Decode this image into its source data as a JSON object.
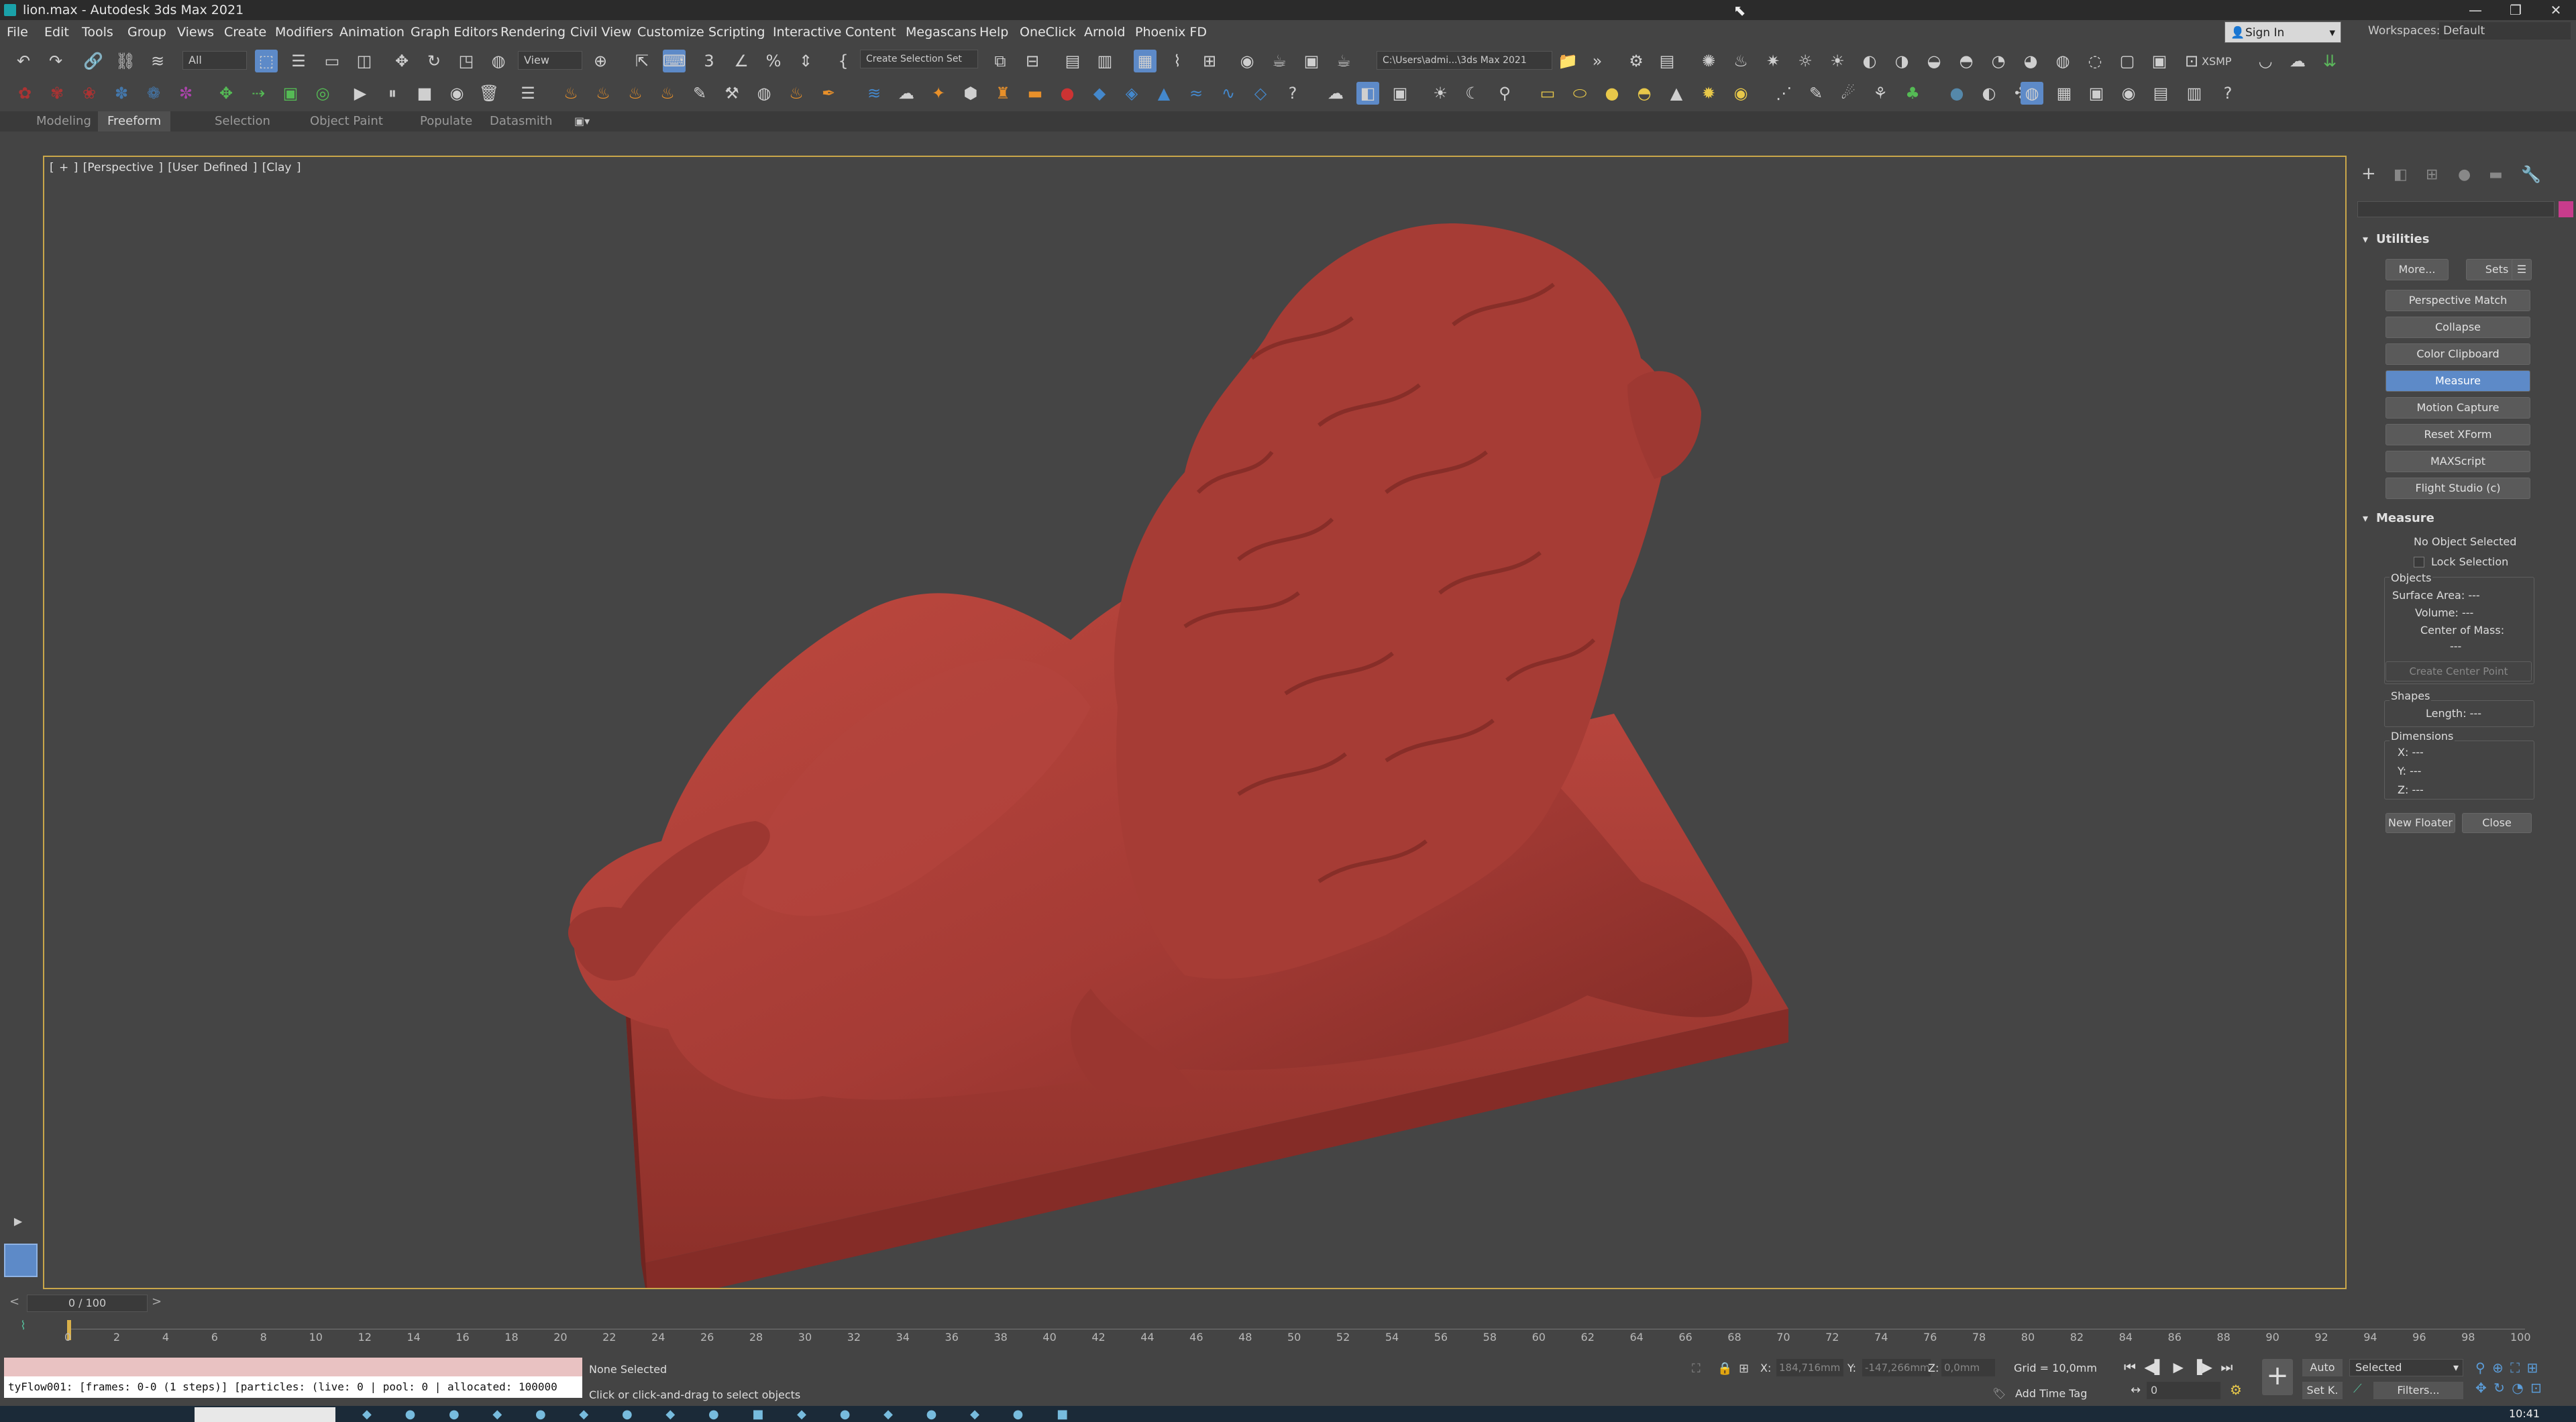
{
  "window": {
    "title": "lion.max - Autodesk 3ds Max 2021",
    "minimize": "—",
    "restore": "❐",
    "close": "✕"
  },
  "menu": [
    "File",
    "Edit",
    "Tools",
    "Group",
    "Views",
    "Create",
    "Modifiers",
    "Animation",
    "Graph Editors",
    "Rendering",
    "Civil View",
    "Customize",
    "Scripting",
    "Interactive",
    "Content",
    "Megascans",
    "Help",
    "OneClick",
    "Arnold",
    "Phoenix FD"
  ],
  "header": {
    "sign_in": "Sign In",
    "workspaces_label": "Workspaces:",
    "workspace_value": "Default"
  },
  "toolbar": {
    "filter_value": "All",
    "refcoord_value": "View",
    "selection_set_placeholder": "Create Selection Set",
    "project_path": "C:\\Users\\admi...\\3ds Max 2021",
    "xsmp_label": "XSMP"
  },
  "ribbon_tabs": [
    "Modeling",
    "Freeform",
    "Selection",
    "Object Paint",
    "Populate",
    "Datasmith"
  ],
  "ribbon_active": "Freeform",
  "viewport": {
    "label": "[ + ] [Perspective ] [User Defined ] [Clay ]",
    "object_color": "#b1413a",
    "background": "#454545"
  },
  "utilities": {
    "title": "Utilities",
    "more_label": "More...",
    "sets_label": "Sets",
    "buttons": [
      "Perspective Match",
      "Collapse",
      "Color Clipboard",
      "Measure",
      "Motion Capture",
      "Reset XForm",
      "MAXScript",
      "Flight Studio (c)"
    ],
    "active": "Measure"
  },
  "measure": {
    "title": "Measure",
    "no_object": "No Object Selected",
    "lock_selection": "Lock Selection",
    "objects_label": "Objects",
    "surface_area": "Surface Area: ---",
    "volume": "Volume: ---",
    "center_of_mass": "Center of Mass:",
    "com_value": "---",
    "create_center_point": "Create Center Point",
    "shapes_label": "Shapes",
    "length": "Length: ---",
    "dimensions_label": "Dimensions",
    "x": "X: ---",
    "y": "Y: ---",
    "z": "Z: ---",
    "new_floater": "New Floater",
    "close": "Close"
  },
  "timeslider": {
    "frame": "0 / 100",
    "prev": "<",
    "next": ">"
  },
  "trackbar": {
    "ticks": [
      "0",
      "2",
      "4",
      "6",
      "8",
      "10",
      "12",
      "14",
      "16",
      "18",
      "20",
      "22",
      "24",
      "26",
      "28",
      "30",
      "32",
      "34",
      "36",
      "38",
      "40",
      "42",
      "44",
      "46",
      "48",
      "50",
      "52",
      "54",
      "56",
      "58",
      "60",
      "62",
      "64",
      "66",
      "68",
      "70",
      "72",
      "74",
      "76",
      "78",
      "80",
      "82",
      "84",
      "86",
      "88",
      "90",
      "92",
      "94",
      "96",
      "98",
      "100"
    ]
  },
  "status": {
    "listener": "tyFlow001: [frames: 0-0 (1 steps)] [particles: (live: 0 | pool: 0 | allocated: 100000",
    "selection": "None Selected",
    "prompt": "Click or click-and-drag to select objects",
    "x_label": "X:",
    "x_value": "184,716mm",
    "y_label": "Y:",
    "y_value": "-147,266mm",
    "z_label": "Z:",
    "z_value": "0,0mm",
    "grid": "Grid = 10,0mm",
    "add_time_tag": "Add Time Tag",
    "auto_key": "Auto",
    "set_key": "Set K.",
    "key_filter_value": "Selected",
    "filters": "Filters...",
    "current_frame": "0",
    "clock": "10:41"
  }
}
